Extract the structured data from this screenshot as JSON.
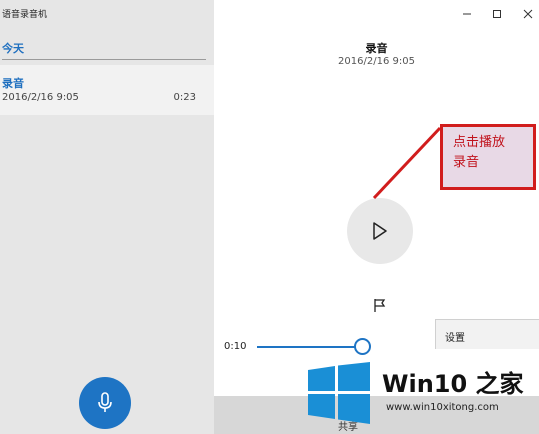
{
  "app": {
    "title": "语音录音机"
  },
  "list": {
    "group_header": "今天",
    "items": [
      {
        "name": "录音",
        "date": "2016/2/16 9:05",
        "duration": "0:23"
      }
    ]
  },
  "detail": {
    "title": "录音",
    "date": "2016/2/16 9:05",
    "elapsed": "0:10",
    "progress_fraction": 0.43
  },
  "context_menu": {
    "settings": "设置"
  },
  "bottom": {
    "share_label": "共享"
  },
  "annotation": {
    "text_line1": "点击播放",
    "text_line2": "录音"
  },
  "watermark": {
    "title": "Win10 之家",
    "url": "www.win10xitong.com"
  },
  "colors": {
    "accent": "#1e74c4",
    "annotation": "#d11d1d"
  },
  "icons": [
    "microphone-icon",
    "play-icon",
    "flag-icon",
    "minimize-icon",
    "maximize-icon",
    "close-icon",
    "windows-logo-icon"
  ]
}
